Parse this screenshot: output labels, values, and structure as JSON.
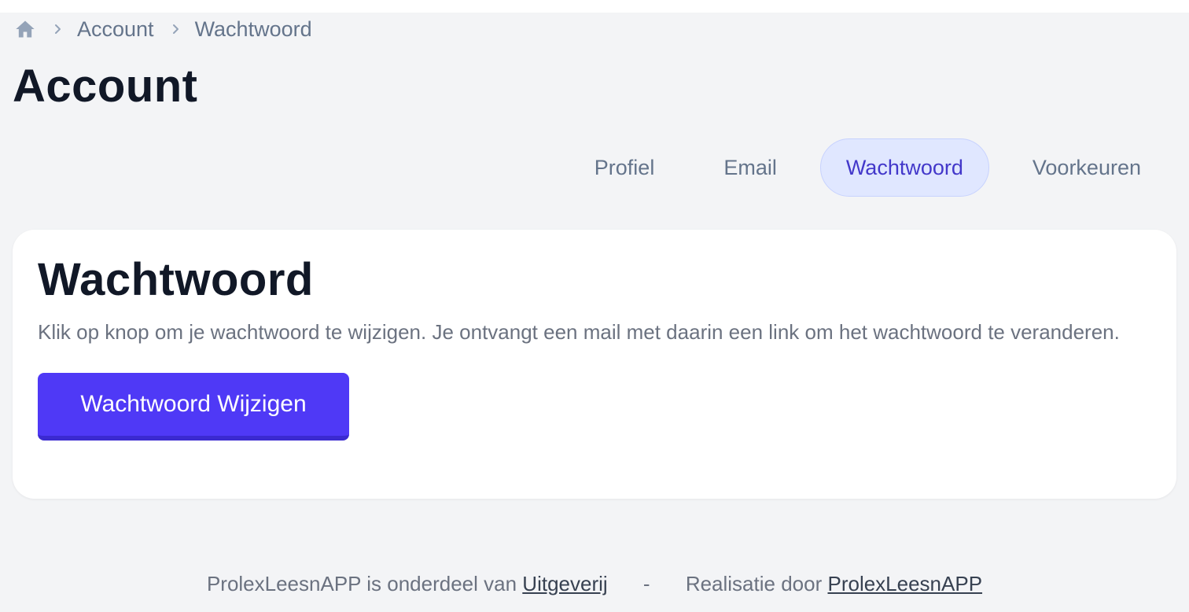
{
  "breadcrumb": {
    "home_icon": "home-icon",
    "items": [
      "Account",
      "Wachtwoord"
    ]
  },
  "page": {
    "title": "Account"
  },
  "tabs": [
    {
      "label": "Profiel",
      "active": false
    },
    {
      "label": "Email",
      "active": false
    },
    {
      "label": "Wachtwoord",
      "active": true
    },
    {
      "label": "Voorkeuren",
      "active": false
    }
  ],
  "card": {
    "title": "Wachtwoord",
    "description": "Klik op knop om je wachtwoord te wijzigen. Je ontvangt een mail met daarin een link om het wachtwoord te veranderen.",
    "button_label": "Wachtwoord Wijzigen"
  },
  "footer": {
    "prefix": "ProlexLeesnAPP is onderdeel van",
    "publisher_link": "Uitgeverij",
    "separator": "-",
    "credit_prefix": "Realisatie door",
    "credit_link": "ProlexLeesnAPP"
  },
  "colors": {
    "background": "#f3f4f6",
    "accent": "#4f39f6",
    "active_tab_bg": "#e0e7ff",
    "active_tab_text": "#4338ca"
  }
}
